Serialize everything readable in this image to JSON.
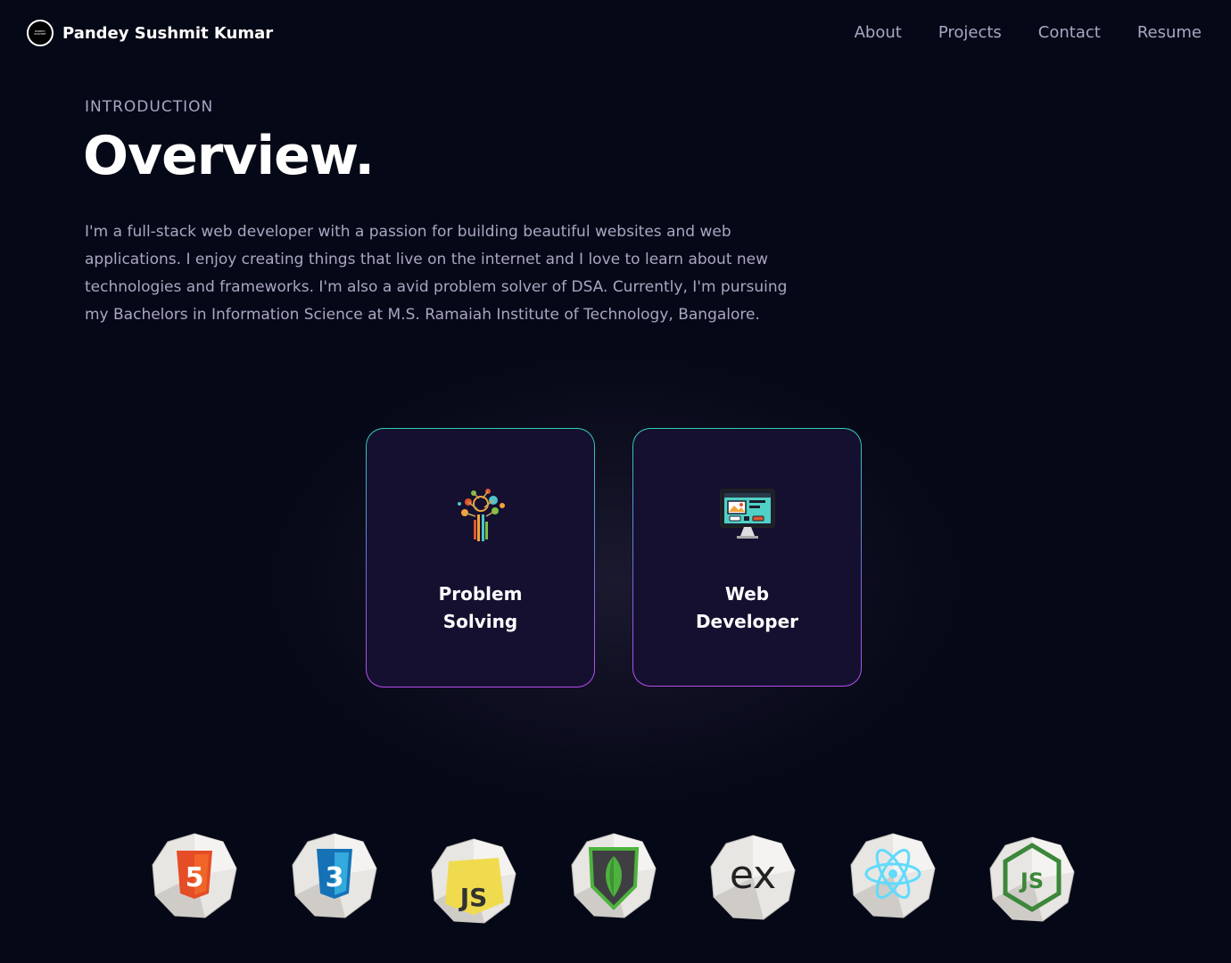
{
  "nav": {
    "brand_name": "Pandey Sushmit Kumar",
    "logo_text": "PANDEY SUSHMIT",
    "links": [
      "About",
      "Projects",
      "Contact",
      "Resume"
    ]
  },
  "intro": {
    "eyebrow": "INTRODUCTION",
    "title": "Overview.",
    "description": "I'm a full-stack web developer with a passion for building beautiful websites and web applications. I enjoy creating things that live on the internet and I love to learn about new technologies and frameworks. I'm also a avid problem solver of DSA. Currently, I'm pursuing my Bachelors in Information Science at M.S. Ramaiah Institute of Technology, Bangalore."
  },
  "services": [
    {
      "title": "Problem Solving",
      "icon": "circuit-tree-icon"
    },
    {
      "title": "Web Developer",
      "icon": "web-monitor-icon"
    }
  ],
  "tech": [
    {
      "icon": "html5-icon",
      "color": "#e44d26",
      "label": "5"
    },
    {
      "icon": "css3-icon",
      "color": "#2965f1",
      "label": "3"
    },
    {
      "icon": "javascript-icon",
      "color": "#f0db4f",
      "label": "JS"
    },
    {
      "icon": "mongodb-icon",
      "color": "#4db33d",
      "label": ""
    },
    {
      "icon": "express-icon",
      "color": "#222222",
      "label": "ex"
    },
    {
      "icon": "react-icon",
      "color": "#61dafb",
      "label": ""
    },
    {
      "icon": "nodejs-icon",
      "color": "#3c873a",
      "label": "JS"
    }
  ],
  "colors": {
    "background": "#050816",
    "secondary_text": "#aaa6c3",
    "card_bg": "#151030",
    "card_border_top": "#2fd0b6",
    "card_border_bottom": "#b84cf0"
  }
}
